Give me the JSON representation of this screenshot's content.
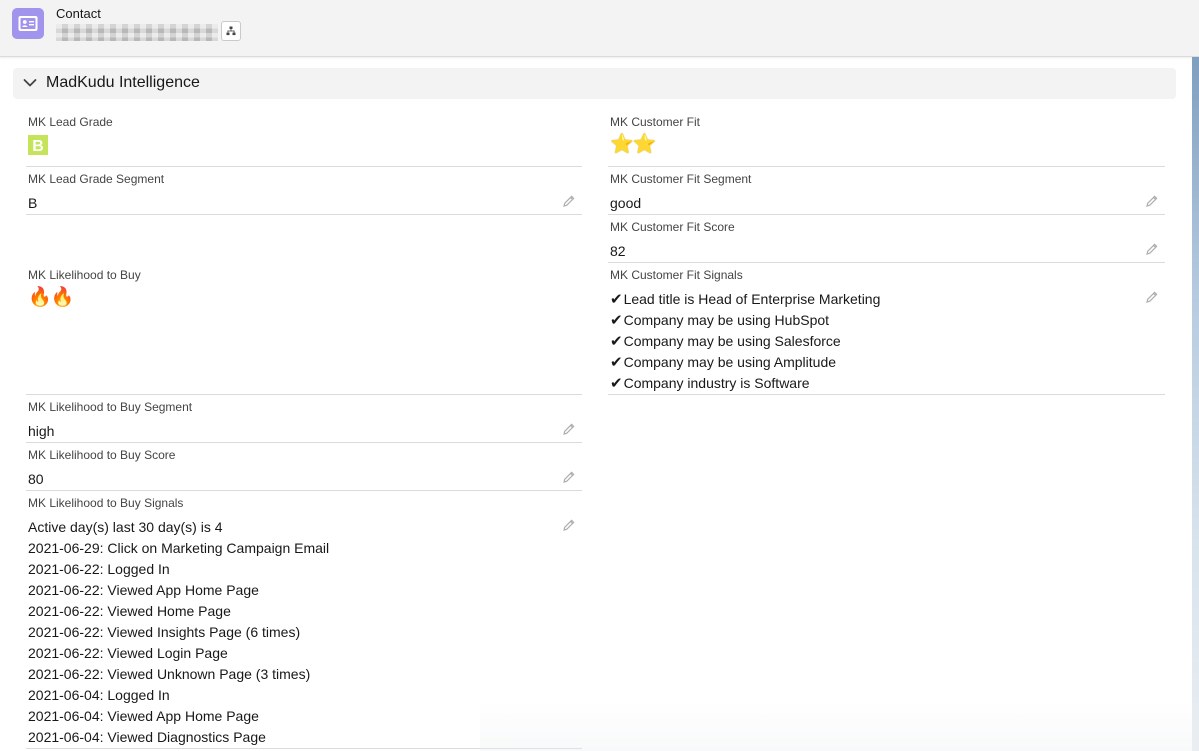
{
  "header": {
    "object_label": "Contact",
    "record_name_redacted": true,
    "icon": "contact-card-icon",
    "hierarchy_icon": "hierarchy-icon"
  },
  "section": {
    "title": "MadKudu Intelligence",
    "expanded": true,
    "toggle_icon": "chevron-down-icon"
  },
  "fields": {
    "lead_grade": {
      "label": "MK Lead Grade",
      "value": "B",
      "color": "#c5e45a"
    },
    "customer_fit": {
      "label": "MK Customer Fit",
      "value": "⭐⭐",
      "stars": 2
    },
    "lead_grade_segment": {
      "label": "MK Lead Grade Segment",
      "value": "B"
    },
    "customer_fit_segment": {
      "label": "MK Customer Fit Segment",
      "value": "good"
    },
    "customer_fit_score": {
      "label": "MK Customer Fit Score",
      "value": "82"
    },
    "likelihood_to_buy": {
      "label": "MK Likelihood to Buy",
      "value": "🔥🔥",
      "flames": 2
    },
    "customer_fit_signals": {
      "label": "MK Customer Fit Signals",
      "check_glyph": "✔",
      "items": [
        "Lead title is Head of Enterprise Marketing",
        "Company may be using HubSpot",
        "Company may be using Salesforce",
        "Company may be using Amplitude",
        "Company industry is Software"
      ]
    },
    "likelihood_segment": {
      "label": "MK Likelihood to Buy Segment",
      "value": "high"
    },
    "likelihood_score": {
      "label": "MK Likelihood to Buy Score",
      "value": "80"
    },
    "likelihood_signals": {
      "label": "MK Likelihood to Buy Signals",
      "items": [
        "Active day(s) last 30 day(s) is 4",
        "2021-06-29: Click on Marketing Campaign Email",
        "2021-06-22: Logged In",
        "2021-06-22: Viewed App Home Page",
        "2021-06-22: Viewed Home Page",
        "2021-06-22: Viewed Insights Page (6 times)",
        "2021-06-22: Viewed Login Page",
        "2021-06-22: Viewed Unknown Page (3 times)",
        "2021-06-04: Logged In",
        "2021-06-04: Viewed App Home Page",
        "2021-06-04: Viewed Diagnostics Page"
      ]
    }
  },
  "edit_icon": "pencil-icon"
}
